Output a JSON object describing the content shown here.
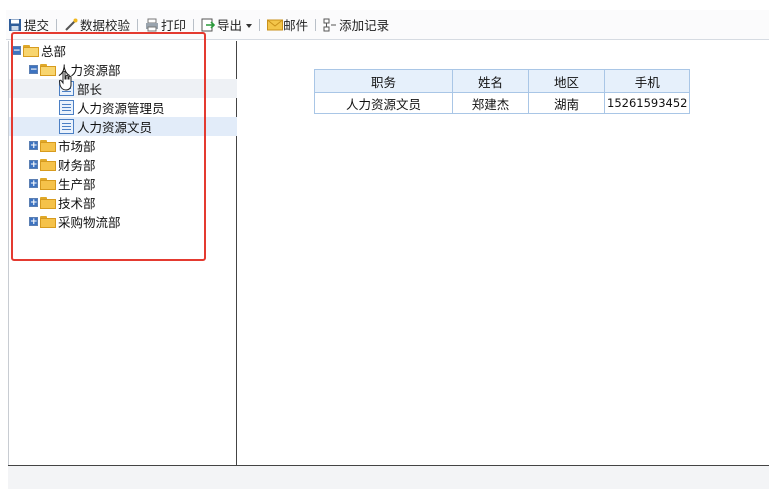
{
  "toolbar": {
    "submit_label": "提交",
    "validate_label": "数据校验",
    "print_label": "打印",
    "export_label": "导出",
    "mail_label": "邮件",
    "add_record_label": "添加记录"
  },
  "tree": {
    "root": "总部",
    "hr_dept": "人力资源部",
    "hr_children": [
      "部长",
      "人力资源管理员",
      "人力资源文员"
    ],
    "other_depts": [
      "市场部",
      "财务部",
      "生产部",
      "技术部",
      "采购物流部"
    ]
  },
  "table": {
    "columns": [
      "职务",
      "姓名",
      "地区",
      "手机"
    ],
    "rows": [
      [
        "人力资源文员",
        "郑建杰",
        "湖南",
        "15261593452"
      ]
    ]
  },
  "colors": {
    "highlight_box": "#e43a30",
    "selected_row": "#e2ecf9",
    "header_bg": "#e6f0fb"
  }
}
